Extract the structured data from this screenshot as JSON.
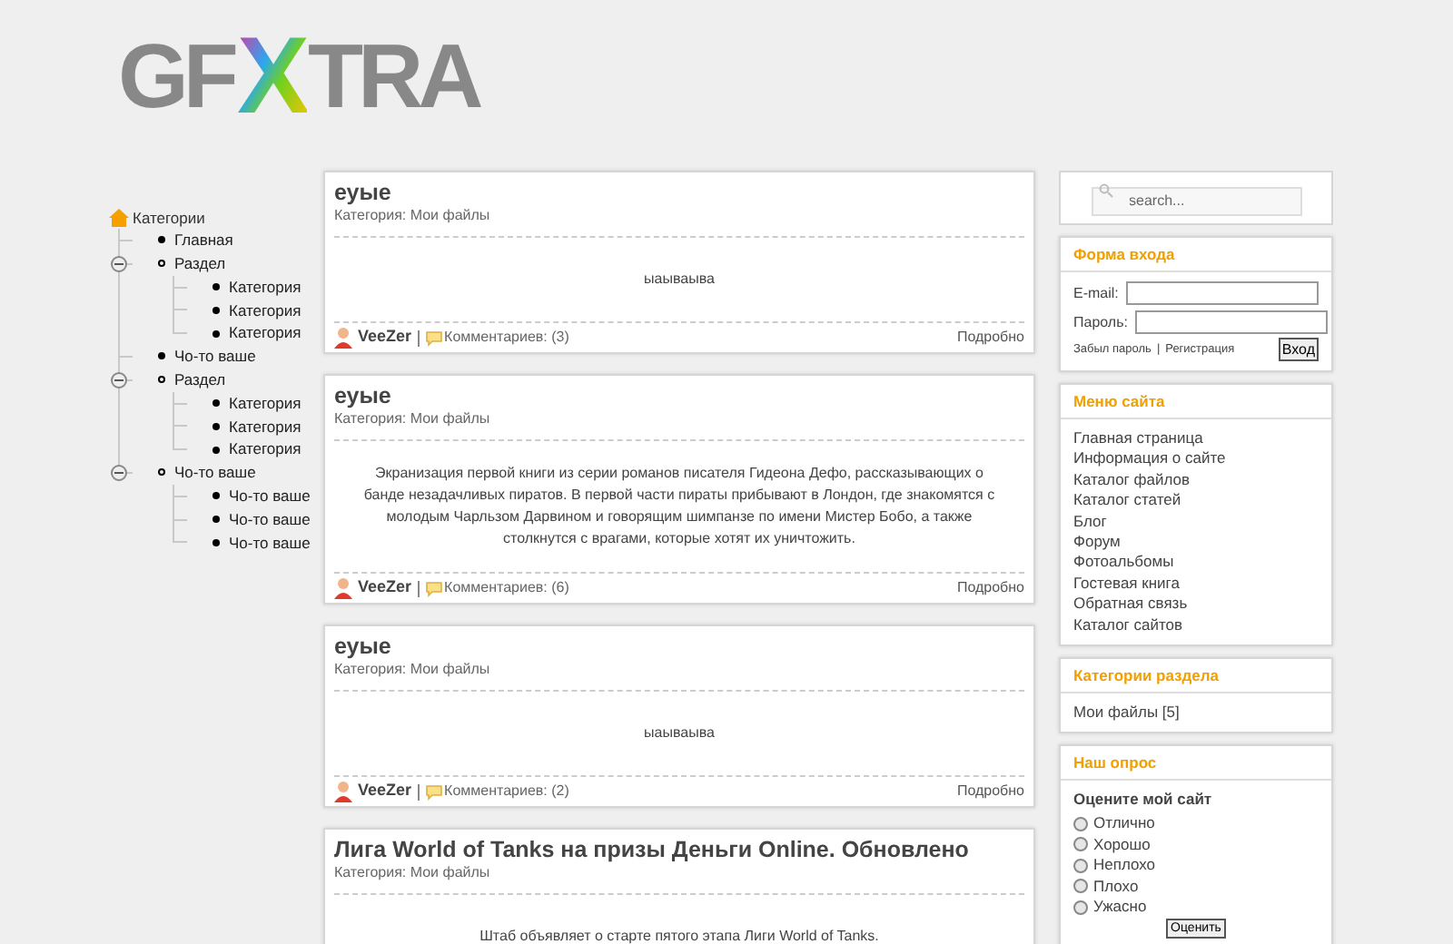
{
  "logo": {
    "parts": [
      "GF",
      "X",
      "TRA"
    ]
  },
  "tree": {
    "label": "Категории",
    "children": [
      {
        "label": "Главная",
        "expanded": false
      },
      {
        "label": "Раздел",
        "expanded": true,
        "children": [
          {
            "label": "Категория",
            "expanded": false
          },
          {
            "label": "Категория",
            "expanded": false
          },
          {
            "label": "Категория",
            "expanded": false
          }
        ]
      },
      {
        "label": "Чо-то ваше",
        "expanded": false
      },
      {
        "label": "Раздел",
        "expanded": true,
        "children": [
          {
            "label": "Категория",
            "expanded": false
          },
          {
            "label": "Категория",
            "expanded": false
          },
          {
            "label": "Категория",
            "expanded": false
          }
        ]
      },
      {
        "label": "Чо-то ваше",
        "expanded": true,
        "children": [
          {
            "label": "Чо-то ваше",
            "expanded": false
          },
          {
            "label": "Чо-то ваше",
            "expanded": false
          },
          {
            "label": "Чо-то ваше",
            "expanded": false
          }
        ]
      }
    ]
  },
  "posts": [
    {
      "title": "еуые",
      "category": "Категория: Мои файлы",
      "body": "ыаываыва",
      "author": "VeeZer",
      "comments": "Комментариев: (3)",
      "more": "Подробно"
    },
    {
      "title": "еуые",
      "category": "Категория: Мои файлы",
      "body": "Экранизация первой книги из серии романов писателя Гидеона Дефо, рассказывающих о банде незадачливых пиратов. В первой части пираты прибывают в Лондон, где знакомятся с молодым Чарльзом Дарвином и говорящим шимпанзе по имени Мистер Бобо, а также столкнутся с врагами, которые хотят их уничтожить.",
      "author": "VeeZer",
      "comments": "Комментариев: (6)",
      "more": "Подробно"
    },
    {
      "title": "еуые",
      "category": "Категория: Мои файлы",
      "body": "ыаываыва",
      "author": "VeeZer",
      "comments": "Комментариев: (2)",
      "more": "Подробно"
    },
    {
      "title": "Лига World of Tanks на призы Деньги Online. Обновлено",
      "category": "Категория: Мои файлы",
      "body": "Штаб объявляет о старте пятого этапа Лиги World of Tanks."
    }
  ],
  "search": {
    "placeholder": "search..."
  },
  "login": {
    "title": "Форма входа",
    "email_label": "E-mail:",
    "password_label": "Пароль:",
    "forgot": "Забыл пароль",
    "separator": "|",
    "register": "Регистрация",
    "submit": "Вход"
  },
  "site_menu": {
    "title": "Меню сайта",
    "items": [
      "Главная страница",
      "Информация о сайте",
      "Каталог файлов",
      "Каталог статей",
      "Блог",
      "Форум",
      "Фотоальбомы",
      "Гостевая книга",
      "Обратная связь",
      "Каталог сайтов"
    ]
  },
  "section_categories": {
    "title": "Категории раздела",
    "items": [
      "Мои файлы [5]"
    ]
  },
  "poll": {
    "title": "Наш опрос",
    "question": "Оцените мой сайт",
    "options": [
      {
        "label": "Отлично",
        "selected": false
      },
      {
        "label": "Хорошо",
        "selected": false
      },
      {
        "label": "Неплохо",
        "selected": false
      },
      {
        "label": "Плохо",
        "selected": false
      },
      {
        "label": "Ужасно",
        "selected": false
      }
    ],
    "submit": "Оценить"
  }
}
